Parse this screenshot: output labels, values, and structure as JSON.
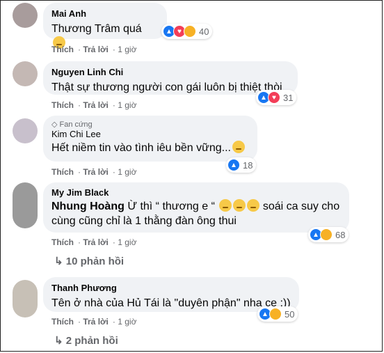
{
  "actions": {
    "like_label": "Thích",
    "reply_label": "Trả lời",
    "time": "1 giờ"
  },
  "comments": [
    {
      "name": "Mai Anh",
      "text": "Thương Trâm quá",
      "count": "40",
      "avatar_color": "#a89c9c"
    },
    {
      "name": "Nguyen Linh Chi",
      "text": "Thật sự thương người con gái luôn bị thiệt thòi",
      "count": "31",
      "avatar_color": "#c4b8b4"
    },
    {
      "badge": "Fan cứng",
      "name": "Kim Chi Lee",
      "text": "Hết niềm tin vào tình iêu bền vững...",
      "count": "18",
      "avatar_color": "#c8c0cc"
    },
    {
      "name": "My Jim Black",
      "mention": "Nhung Hoàng",
      "text_a": "Ừ thì “ thương e “",
      "text_b": "soái ca suy cho",
      "text_c": "cùng cũng chỉ là 1 thằng đàn ông thui",
      "count": "68",
      "avatar_color": "#9a9a9a"
    },
    {
      "name": "Thanh Phương",
      "text": "Tên ở nhà của Hủ Tái là \"duyên phận\" nha ce :))",
      "count": "50",
      "avatar_color": "#c7c0b6"
    }
  ],
  "replies": [
    "10 phản hồi",
    "2 phản hồi"
  ]
}
